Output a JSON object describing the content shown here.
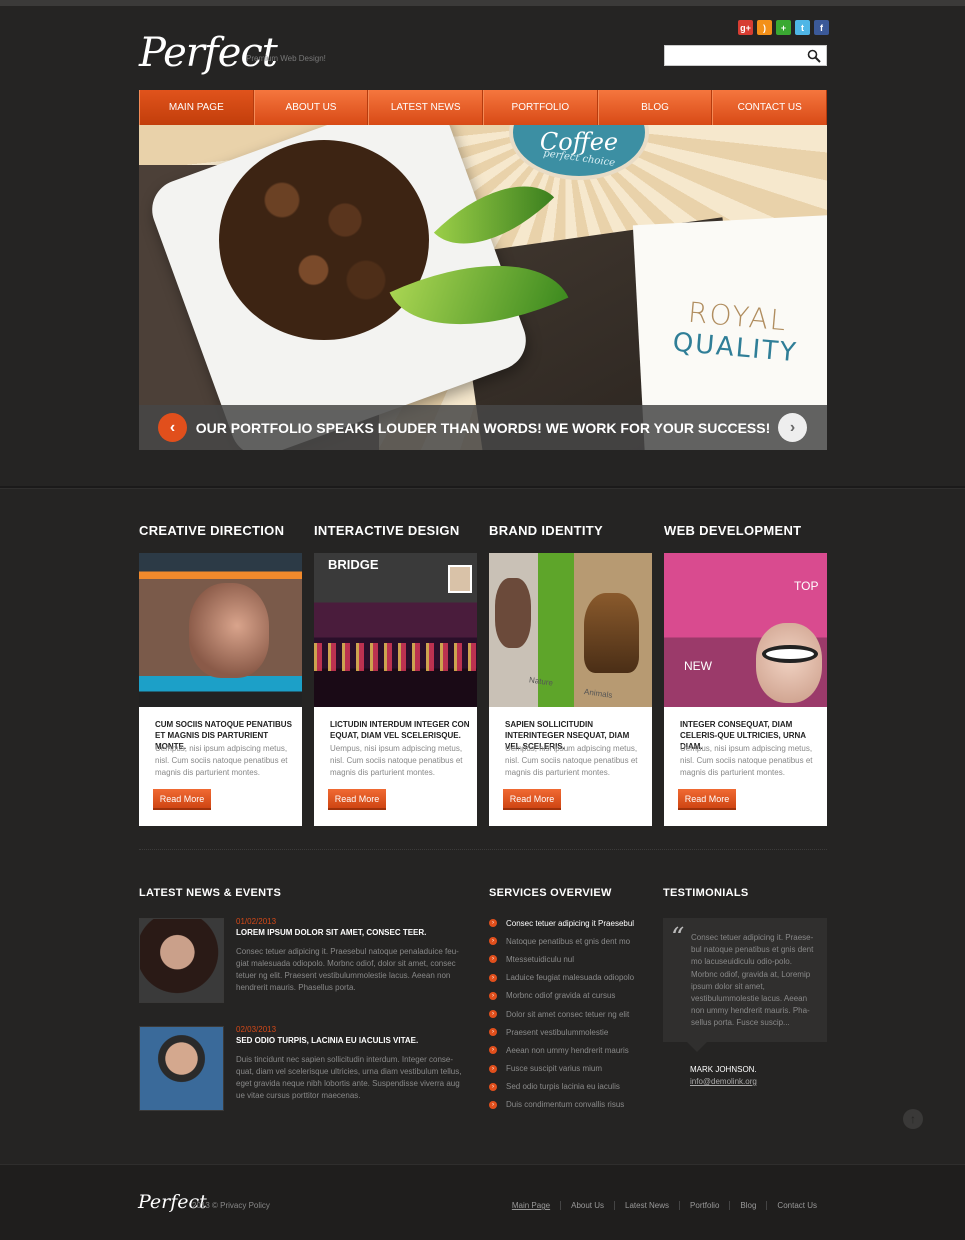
{
  "header": {
    "logo": "Perfect",
    "tagline": "Premium Web Design!",
    "search": {
      "value": "",
      "placeholder": ""
    },
    "social": [
      {
        "name": "google-plus-icon",
        "glyph": "g+",
        "color": "#d73d32"
      },
      {
        "name": "rss-icon",
        "glyph": ")",
        "color": "#f39019"
      },
      {
        "name": "share-plus-icon",
        "glyph": "+",
        "color": "#3aa932"
      },
      {
        "name": "twitter-icon",
        "glyph": "t",
        "color": "#4fb6e6"
      },
      {
        "name": "facebook-icon",
        "glyph": "f",
        "color": "#3b5998"
      }
    ]
  },
  "nav": {
    "items": [
      "MAIN PAGE",
      "ABOUT US",
      "LATEST NEWS",
      "PORTFOLIO",
      "BLOG",
      "CONTACT US"
    ],
    "active": "MAIN PAGE"
  },
  "slider": {
    "badge_title": "Coffee",
    "badge_sub": "perfect choice",
    "royal": "ROYAL",
    "quality": "QUALITY",
    "caption": "OUR PORTFOLIO SPEAKS LOUDER THAN WORDS! WE WORK FOR YOUR SUCCESS!",
    "prev_glyph": "‹",
    "next_glyph": "›"
  },
  "services": [
    {
      "title": "CREATIVE DIRECTION",
      "heading": "CUM SOCIIS NATOQUE PENATIBUS ET MAGNIS DIS PARTURIENT MONTE.",
      "text": "Uempus, nisi ipsum adpiscing metus, nisl. Cum sociis natoque penatibus et magnis dis parturient montes.",
      "button": "Read More"
    },
    {
      "title": "INTERACTIVE DESIGN",
      "heading": "LICTUDIN INTERDUM INTEGER CON EQUAT, DIAM VEL SCELERISQUE.",
      "text": "Uempus, nisi ipsum adpiscing metus, nisl. Cum sociis natoque penatibus et magnis dis parturient montes.",
      "button": "Read More"
    },
    {
      "title": "BRAND IDENTITY",
      "heading": "SAPIEN SOLLICITUDIN INTERINTEGER NSEQUAT, DIAM VEL SCELERIS.",
      "text": "Uempus, nisi ipsum adpiscing metus, nisl. Cum sociis natoque penatibus et magnis dis parturient montes.",
      "button": "Read More"
    },
    {
      "title": "WEB DEVELOPMENT",
      "heading": "INTEGER CONSEQUAT, DIAM CELERIS-QUE ULTRICIES, URNA DIAM.",
      "text": "Uempus, nisi ipsum adpiscing metus, nisl. Cum sociis natoque penatibus et magnis dis parturient montes.",
      "button": "Read More"
    }
  ],
  "card_labels": {
    "bridge": "BRIDGE",
    "nature": "Nature",
    "animals": "Animals",
    "top": "TOP",
    "new": "NEW"
  },
  "news": {
    "heading": "LATEST NEWS & EVENTS",
    "items": [
      {
        "date": "01/02/2013",
        "title": "LOREM IPSUM DOLOR SIT AMET, CONSEC TEER.",
        "text": "Consec tetuer adipicing it. Praesebul natoque penaladuice feu-giat  malesuada odiopolo. Morbnc odiof,  dolor sit amet, consec tetuer ng elit. Praesent vestibulummolestie lacus. Aeean non hendrerit mauris. Phasellus porta."
      },
      {
        "date": "02/03/2013",
        "title": "SED ODIO TURPIS, LACINIA EU IACULIS VITAE.",
        "text": "Duis tincidunt nec sapien sollicitudin interdum. Integer conse-quat, diam vel scelerisque ultricies, urna diam vestibulum tellus, eget gravida neque nibh lobortis ante. Suspendisse viverra aug ue vitae cursus porttitor maecenas."
      }
    ]
  },
  "services_overview": {
    "heading": "SERVICES OVERVIEW",
    "items": [
      "Consec tetuer adipicing it Praesebul",
      "Natoque penatibus et gnis dent mo",
      "Mtessetuidiculu nul",
      "Laduice feugiat  malesuada odiopolo",
      "Morbnc odiof  gravida at cursus",
      "Dolor sit amet consec tetuer ng elit",
      "Praesent vestibulummolestie",
      "Aeean non ummy hendrerit mauris",
      "Fusce suscipit varius mium",
      "Sed odio turpis lacinia eu iaculis",
      "Duis condimentum convallis risus"
    ]
  },
  "testimonials": {
    "heading": "TESTIMONIALS",
    "quote": "Consec tetuer adipicing it. Praese-bul natoque penatibus et gnis dent mo lacuseuidiculu odio-polo. Morbnc odiof,  gravida at, Loremip ipsum dolor sit amet, vestibulummolestie lacus. Aeean non ummy hendrerit mauris. Pha-sellus porta. Fusce suscip...",
    "name": "MARK JOHNSON.",
    "email": "info@demolink.org"
  },
  "footer": {
    "logo": "Perfect",
    "copyright": "2013 © Privacy Policy",
    "links": [
      "Main Page",
      "About Us",
      "Latest News",
      "Portfolio",
      "Blog",
      "Contact Us"
    ]
  },
  "colors": {
    "accent": "#e14f1c",
    "background": "#252423"
  }
}
